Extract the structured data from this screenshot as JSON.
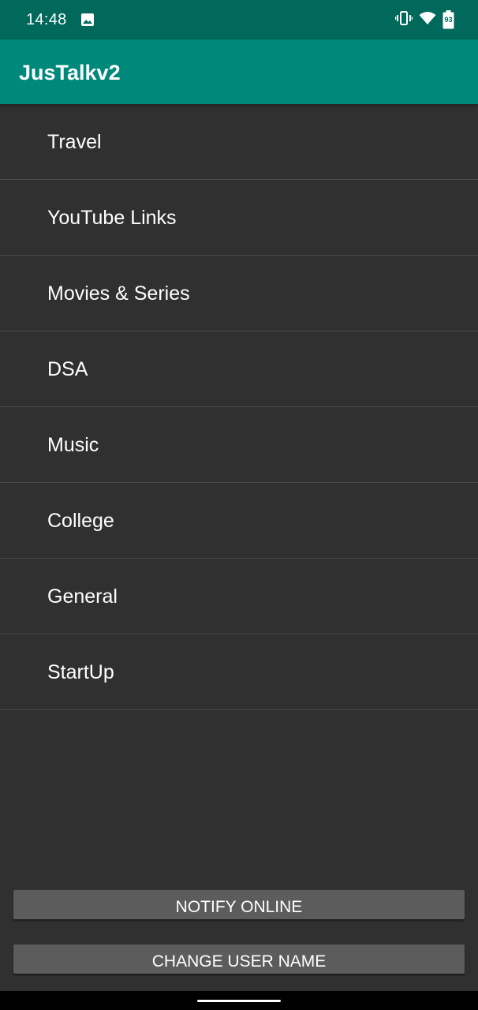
{
  "status_bar": {
    "time": "14:48",
    "battery_level": "93",
    "icons": [
      "image-icon",
      "vibrate-icon",
      "wifi-icon",
      "battery-icon"
    ]
  },
  "app_bar": {
    "title": "JusTalkv2"
  },
  "topics": [
    {
      "label": "Travel"
    },
    {
      "label": "YouTube Links"
    },
    {
      "label": "Movies & Series"
    },
    {
      "label": "DSA"
    },
    {
      "label": "Music"
    },
    {
      "label": "College"
    },
    {
      "label": "General"
    },
    {
      "label": "StartUp"
    }
  ],
  "actions": {
    "notify_online_label": "NOTIFY ONLINE",
    "change_user_name_label": "CHANGE USER NAME"
  },
  "colors": {
    "status_bar": "#00695c",
    "app_bar": "#00897b",
    "background": "#303030",
    "button": "#5c5c5d",
    "divider": "#4a4a4a"
  }
}
